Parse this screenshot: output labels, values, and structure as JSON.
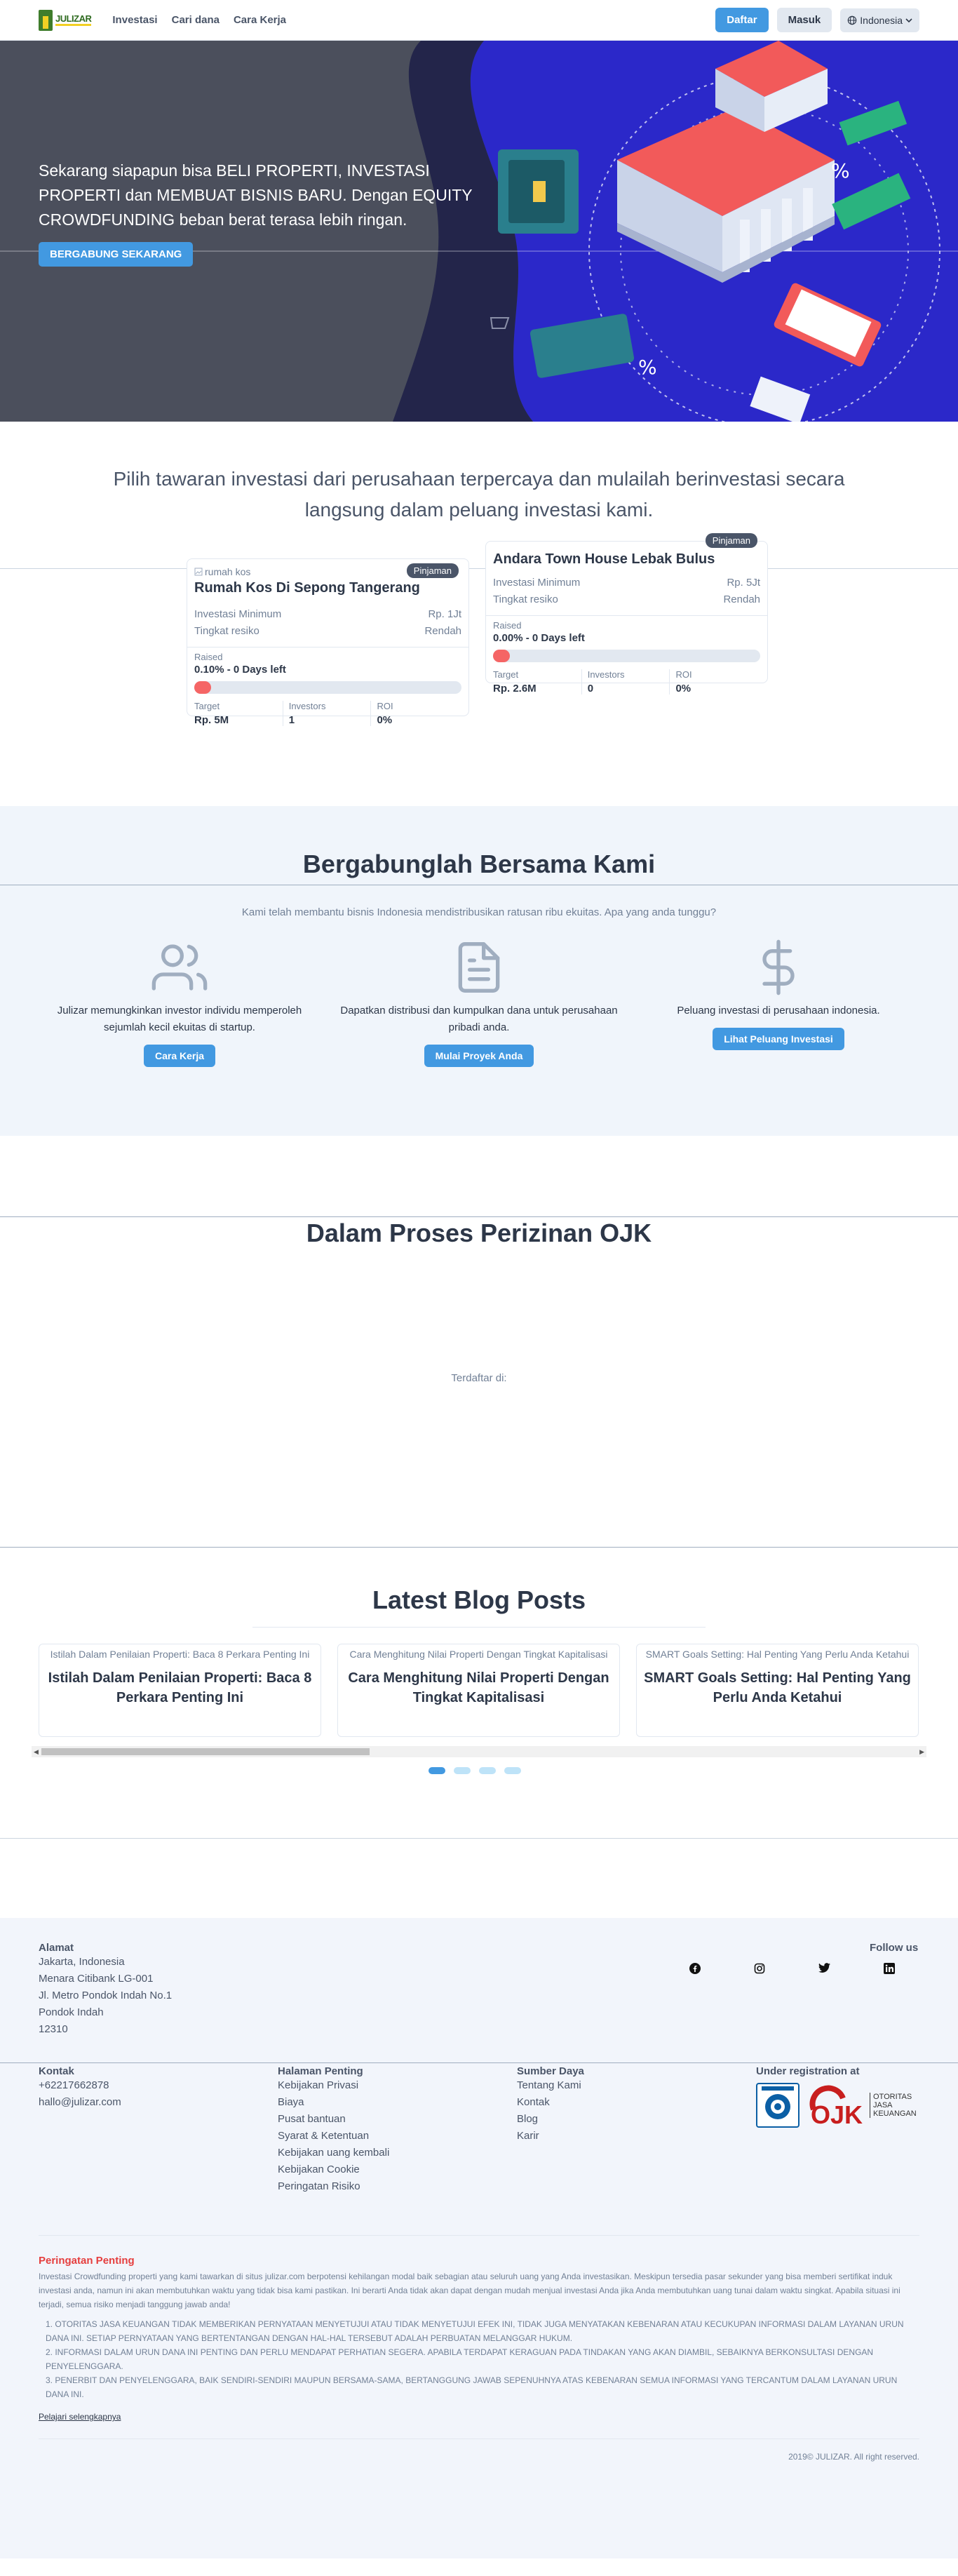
{
  "nav": {
    "logo_text": "JULIZAR",
    "links": [
      "Investasi",
      "Cari dana",
      "Cara Kerja"
    ],
    "register": "Daftar",
    "login": "Masuk",
    "language": "Indonesia"
  },
  "hero": {
    "headline": "Sekarang siapapun bisa BELI PROPERTI, INVESTASI PROPERTI dan MEMBUAT BISNIS BARU. Dengan EQUITY CROWDFUNDING beban berat terasa lebih ringan.",
    "cta": "BERGABUNG SEKARANG",
    "percent_sign": "%"
  },
  "offers": {
    "intro": "Pilih tawaran investasi dari perusahaan terpercaya dan mulailah berinvestasi secara langsung dalam peluang investasi kami.",
    "cards": [
      {
        "image_alt": "rumah kos",
        "tag": "Pinjaman",
        "title": "Rumah Kos Di Sepong Tangerang",
        "min_label": "Investasi Minimum",
        "min_value": "Rp. 1Jt",
        "risk_label": "Tingkat resiko",
        "risk_value": "Rendah",
        "raised_label": "Raised",
        "raised_value": "0.10% - 0 Days left",
        "progress": 0.001,
        "target_label": "Target",
        "target_value": "Rp. 5M",
        "investors_label": "Investors",
        "investors_value": "1",
        "roi_label": "ROI",
        "roi_value": "0%"
      },
      {
        "image_alt": "",
        "tag": "Pinjaman",
        "title": "Andara Town House Lebak Bulus",
        "min_label": "Investasi Minimum",
        "min_value": "Rp. 5Jt",
        "risk_label": "Tingkat resiko",
        "risk_value": "Rendah",
        "raised_label": "Raised",
        "raised_value": "0.00% - 0 Days left",
        "progress": 0.0,
        "target_label": "Target",
        "target_value": "Rp. 2.6M",
        "investors_label": "Investors",
        "investors_value": "0",
        "roi_label": "ROI",
        "roi_value": "0%"
      }
    ]
  },
  "join": {
    "title": "Bergabunglah Bersama Kami",
    "subtitle": "Kami telah membantu bisnis Indonesia mendistribusikan ratusan ribu ekuitas. Apa yang anda tunggu?",
    "columns": [
      {
        "icon": "users-icon",
        "text": "Julizar memungkinkan investor individu memperoleh sejumlah kecil ekuitas di startup.",
        "button": "Cara Kerja"
      },
      {
        "icon": "document-icon",
        "text": "Dapatkan distribusi dan kumpulkan dana untuk perusahaan pribadi anda.",
        "button": "Mulai Proyek Anda"
      },
      {
        "icon": "dollar-icon",
        "text": "Peluang investasi di perusahaan indonesia.",
        "button": "Lihat Peluang Investasi"
      }
    ]
  },
  "ojk": {
    "title": "Dalam Proses Perizinan OJK",
    "registered": "Terdaftar di:"
  },
  "blog": {
    "title": "Latest Blog Posts",
    "posts": [
      {
        "image_alt": "Istilah Dalam Penilaian Properti: Baca 8 Perkara Penting Ini",
        "title": "Istilah Dalam Penilaian Properti: Baca 8 Perkara Penting Ini"
      },
      {
        "image_alt": "Cara Menghitung Nilai Properti Dengan Tingkat Kapitalisasi",
        "title": "Cara Menghitung Nilai Properti Dengan Tingkat Kapitalisasi"
      },
      {
        "image_alt": "SMART Goals Setting: Hal Penting Yang Perlu Anda Ketahui",
        "title": "SMART Goals Setting: Hal Penting Yang Perlu Anda Ketahui"
      }
    ]
  },
  "footer": {
    "address_title": "Alamat",
    "address_lines": [
      "Jakarta, Indonesia",
      "Menara Citibank LG-001",
      "Jl. Metro Pondok Indah No.1",
      "Pondok Indah",
      "12310"
    ],
    "follow": "Follow us",
    "contact_title": "Kontak",
    "contact_lines": [
      "+62217662878",
      "hallo@julizar.com"
    ],
    "pages_title": "Halaman Penting",
    "pages": [
      "Kebijakan Privasi",
      "Biaya",
      "Pusat bantuan",
      "Syarat & Ketentuan",
      "Kebijakan uang kembali",
      "Kebijakan Cookie",
      "Peringatan Risiko"
    ],
    "resources_title": "Sumber Daya",
    "resources": [
      "Tentang Kami",
      "Kontak",
      "Blog",
      "Karir"
    ],
    "registration_title": "Under registration at",
    "ojk_text": [
      "OTORITAS",
      "JASA",
      "KEUANGAN"
    ],
    "warning_title": "Peringatan Penting",
    "warning_text": "Investasi Crowdfunding properti yang kami tawarkan di situs julizar.com berpotensi kehilangan modal baik sebagian atau seluruh uang yang Anda investasikan. Meskipun tersedia pasar sekunder yang bisa memberi sertifikat induk investasi anda, namun ini akan membutuhkan waktu yang tidak bisa kami pastikan. Ini berarti Anda tidak akan dapat dengan mudah menjual investasi Anda jika Anda membutuhkan uang tunai dalam waktu singkat. Apabila situasi ini terjadi, semua risiko menjadi tanggung jawab anda!",
    "warning_points": [
      "1. OTORITAS JASA KEUANGAN TIDAK MEMBERIKAN PERNYATAAN MENYETUJUI ATAU TIDAK MENYETUJUI EFEK INI, TIDAK JUGA MENYATAKAN KEBENARAN ATAU KECUKUPAN INFORMASI DALAM LAYANAN URUN DANA INI. SETIAP PERNYATAAN YANG BERTENTANGAN DENGAN HAL-HAL TERSEBUT ADALAH PERBUATAN MELANGGAR HUKUM.",
      "2. INFORMASI DALAM URUN DANA INI PENTING DAN PERLU MENDAPAT PERHATIAN SEGERA. APABILA TERDAPAT KERAGUAN PADA TINDAKAN YANG AKAN DIAMBIL, SEBAIKNYA BERKONSULTASI DENGAN PENYELENGGARA.",
      "3. PENERBIT DAN PENYELENGGARA, BAIK SENDIRI-SENDIRI MAUPUN BERSAMA-SAMA, BERTANGGUNG JAWAB SEPENUHNYA ATAS KEBENARAN SEMUA INFORMASI YANG TERCANTUM DALAM LAYANAN URUN DANA INI."
    ],
    "learn_more": "Pelajari selengkapnya",
    "copyright": "2019© JULIZAR. All right reserved."
  }
}
